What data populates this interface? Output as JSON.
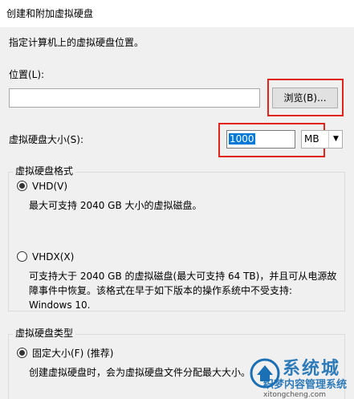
{
  "window": {
    "title": "创建和附加虚拟硬盘"
  },
  "intro": "指定计算机上的虚拟硬盘位置。",
  "location": {
    "label": "位置(L):",
    "value": "",
    "browse_label": "浏览(B)..."
  },
  "size": {
    "label": "虚拟硬盘大小(S):",
    "value": "1000",
    "unit": "MB"
  },
  "format_group": {
    "title": "虚拟硬盘格式",
    "options": [
      {
        "label": "VHD(V)",
        "checked": true,
        "desc": [
          "最大可支持 2040 GB 大小的虚拟磁盘。"
        ]
      },
      {
        "label": "VHDX(X)",
        "checked": false,
        "desc": [
          "可支持大于 2040 GB 的虚拟磁盘(最大可支持 64 TB)，并且可从电源故",
          "障事件中恢复。该格式在早于如下版本的操作系统中不受支持:",
          "Windows 10."
        ]
      }
    ]
  },
  "type_group": {
    "title": "虚拟硬盘类型",
    "options": [
      {
        "label": "固定大小(F) (推荐)",
        "checked": true,
        "desc": [
          "创建虚拟硬盘时，会为虚拟硬盘文件分配最大大小。"
        ]
      }
    ]
  },
  "watermark": {
    "brand": "系统城",
    "site": "织梦内容管理系统",
    "url": "xitongcheng.com"
  },
  "colors": {
    "highlight": "#e2231a",
    "selection": "#0078d7",
    "watermark": "#1a6fb5"
  }
}
